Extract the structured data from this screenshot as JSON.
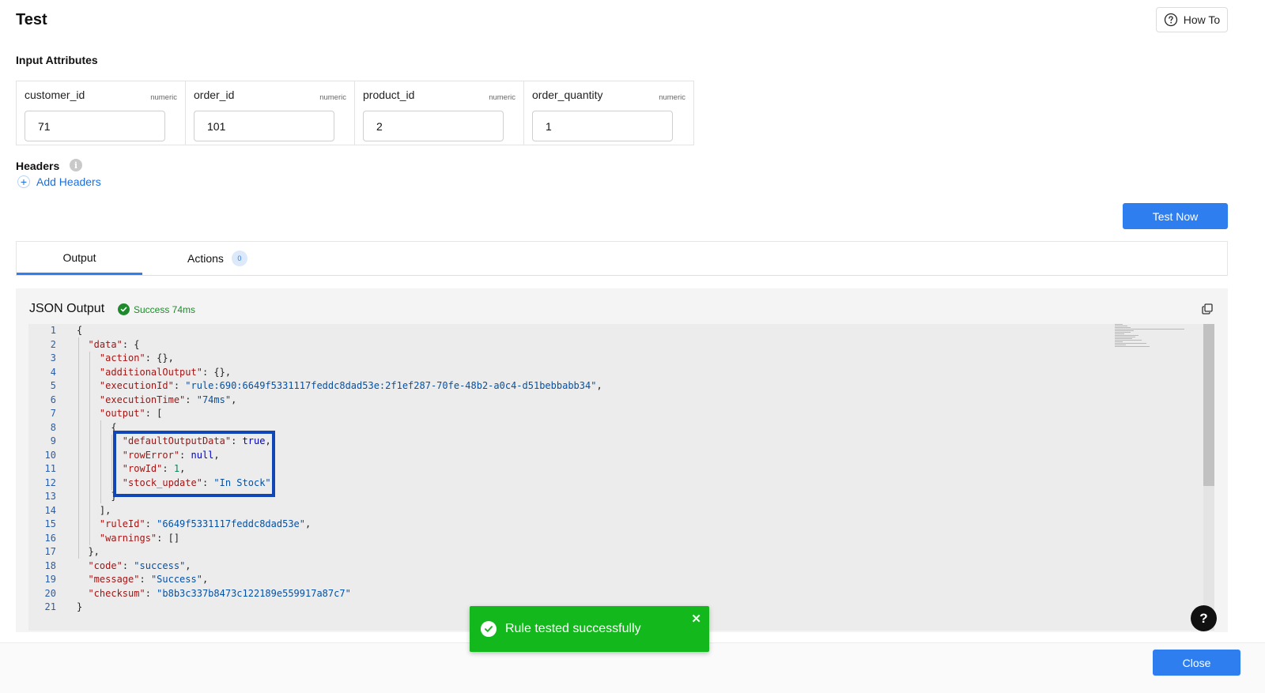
{
  "page": {
    "title": "Test",
    "howto_label": "How To"
  },
  "input_attributes": {
    "label": "Input Attributes",
    "fields": [
      {
        "name": "customer_id",
        "type": "numeric",
        "value": "71"
      },
      {
        "name": "order_id",
        "type": "numeric",
        "value": "101"
      },
      {
        "name": "product_id",
        "type": "numeric",
        "value": "2"
      },
      {
        "name": "order_quantity",
        "type": "numeric",
        "value": "1"
      }
    ]
  },
  "headers": {
    "label": "Headers",
    "info_glyph": "i",
    "add_label": "Add Headers"
  },
  "test_now_label": "Test Now",
  "tabs": {
    "output_label": "Output",
    "actions_label": "Actions",
    "actions_count": "0"
  },
  "output": {
    "title": "JSON Output",
    "status": "Success 74ms",
    "line_numbers": [
      "1",
      "2",
      "3",
      "4",
      "5",
      "6",
      "7",
      "8",
      "9",
      "10",
      "11",
      "12",
      "13",
      "14",
      "15",
      "16",
      "17",
      "18",
      "19",
      "20",
      "21"
    ],
    "lines": [
      "{",
      "  \"data\": {",
      "    \"action\": {},",
      "    \"additionalOutput\": {},",
      "    \"executionId\": \"rule:690:6649f5331117feddc8dad53e:2f1ef287-70fe-48b2-a0c4-d51bebbabb34\",",
      "    \"executionTime\": \"74ms\",",
      "    \"output\": [",
      "      {",
      "        \"defaultOutputData\": true,",
      "        \"rowError\": null,",
      "        \"rowId\": 1,",
      "        \"stock_update\": \"In Stock\"",
      "      }",
      "    ],",
      "    \"ruleId\": \"6649f5331117feddc8dad53e\",",
      "    \"warnings\": []",
      "  },",
      "  \"code\": \"success\",",
      "  \"message\": \"Success\",",
      "  \"checksum\": \"b8b3c337b8473c122189e559917a87c7\"",
      "}"
    ]
  },
  "toast": {
    "message": "Rule tested successfully",
    "close_glyph": "✕"
  },
  "help_glyph": "?",
  "close_label": "Close",
  "colors": {
    "primary": "#2f7ef0",
    "success": "#13b81c",
    "highlight": "#1046b5"
  }
}
